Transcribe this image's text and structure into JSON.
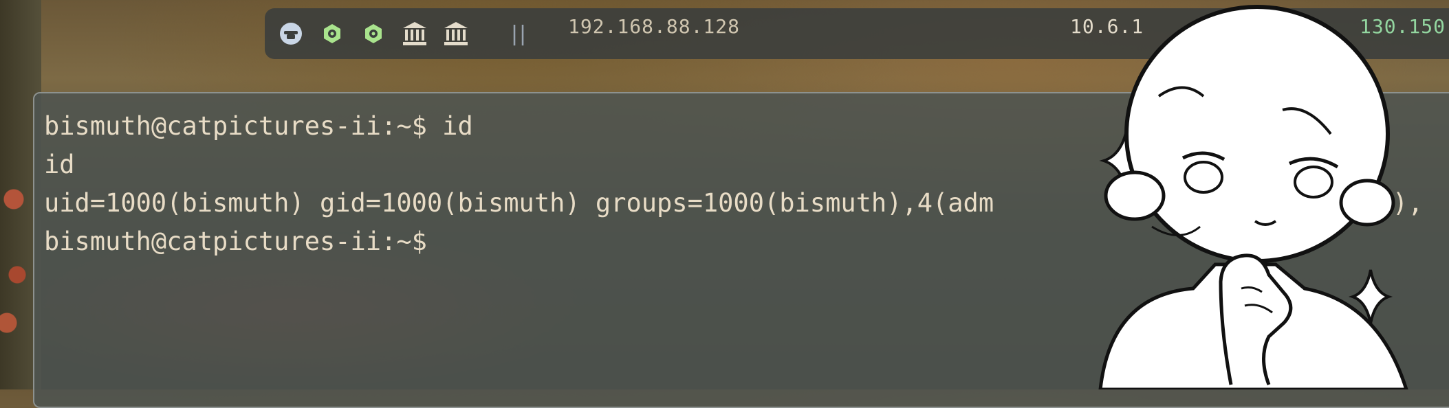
{
  "statusbar": {
    "icons": [
      "hat-icon",
      "hexagon-icon",
      "hexagon-icon",
      "bank-icon",
      "bank-icon"
    ],
    "separator": "||",
    "ip_primary": "192.168.88.128",
    "ip_vpn": "10.6.1",
    "ip_target": "130.150"
  },
  "terminal": {
    "lines": [
      "bismuth@catpictures-ii:~$ id",
      "id",
      "uid=1000(bismuth) gid=1000(bismuth) groups=1000(bismuth),4(adm",
      "bismuth@catpictures-ii:~$"
    ],
    "line3_tail": "dip),"
  },
  "colors": {
    "text": "#e8dcc6",
    "icon_accent": "#a9e38d",
    "icon_muted": "#c9d6e6",
    "ip_primary": "#d0c6b0",
    "ip_target": "#93d6a0"
  }
}
